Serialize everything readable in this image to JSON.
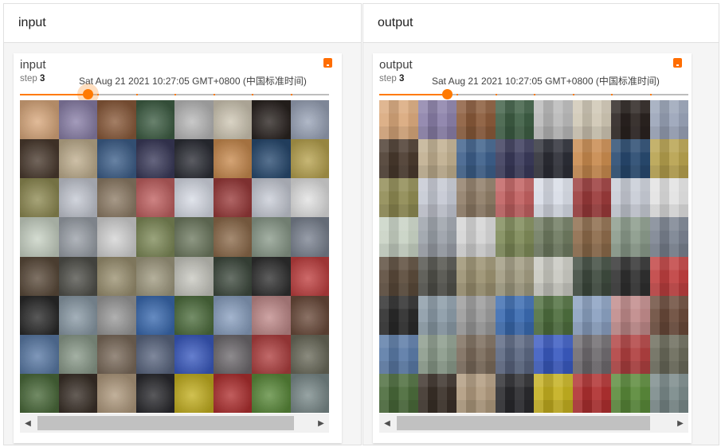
{
  "panels": [
    {
      "header": "input",
      "card": {
        "title": "input",
        "step_label": "step",
        "step_value": "3",
        "timestamp": "Sat Aug 21 2021 10:27:05 GMT+0800 (中国标准时间)",
        "slider_value": 0.22,
        "download_icon": "download-icon"
      }
    },
    {
      "header": "output",
      "card": {
        "title": "output",
        "step_label": "step",
        "step_value": "3",
        "timestamp": "Sat Aug 21 2021 10:27:05 GMT+0800 (中国标准时间)",
        "slider_value": 0.22,
        "download_icon": "download-icon"
      }
    }
  ],
  "scrollbar": {
    "left_arrow": "◀",
    "right_arrow": "▶"
  },
  "colors": {
    "accent": "#ff7a00",
    "image_tiles": [
      "#d9a87c",
      "#8a7fa8",
      "#8a5a3a",
      "#3e5e44",
      "#b9b9b9",
      "#cfc7b4",
      "#2a2320",
      "#9aa4b8",
      "#4a3a2e",
      "#bfae8e",
      "#3d5f8a",
      "#3a3a5a",
      "#2c2e36",
      "#c88a4e",
      "#284a70",
      "#b7a24e",
      "#8e8a52",
      "#c4c8d2",
      "#8e7c66",
      "#c06060",
      "#d8dce6",
      "#9a3a3a",
      "#c8ccd6",
      "#e2e2e2",
      "#c8d2c4",
      "#9aa0a8",
      "#d4d4d4",
      "#7e8a58",
      "#6e7a60",
      "#8c6a4a",
      "#8a9a8a",
      "#7a8290",
      "#5a4a3a",
      "#50504a",
      "#9a9070",
      "#a09a80",
      "#c8c8c0",
      "#3e4a3e",
      "#303030",
      "#c04040",
      "#2a2a2a",
      "#8a9aa6",
      "#9a9a9a",
      "#3a6ab0",
      "#4e6e3e",
      "#8aa0c0",
      "#c08a8a",
      "#6a4a3a",
      "#5a7aa6",
      "#8a9a8a",
      "#7a6a5a",
      "#5a6680",
      "#3a5ac0",
      "#6e6a6e",
      "#b04040",
      "#6a6a5a",
      "#4a6a3a",
      "#3a3028",
      "#b09a7e",
      "#2a2a2e",
      "#c4b020",
      "#b03030",
      "#5a8a3a",
      "#7a8a8a"
    ]
  }
}
